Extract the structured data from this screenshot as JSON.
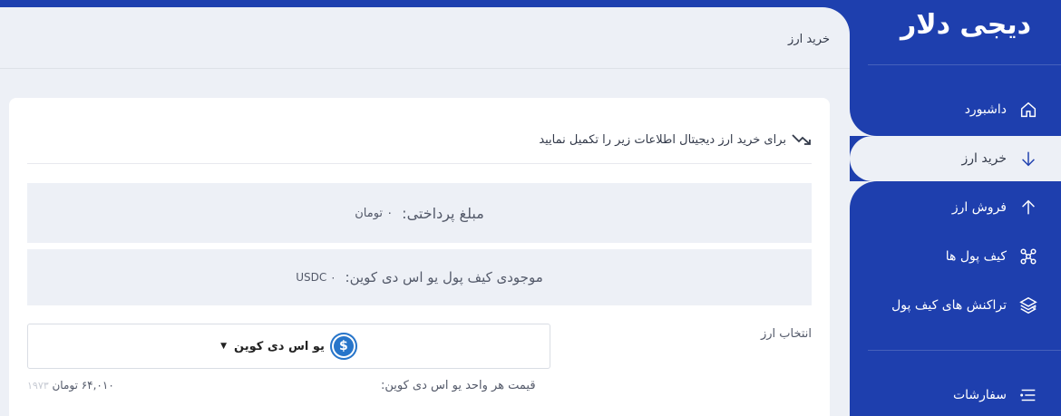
{
  "sidebar": {
    "logo": "دیجی دلار",
    "items": [
      {
        "label": "داشبورد",
        "icon": "home-icon"
      },
      {
        "label": "خرید ارز",
        "icon": "arrow-down-icon",
        "active": true
      },
      {
        "label": "فروش ارز",
        "icon": "arrow-up-icon"
      },
      {
        "label": "کیف پول ها",
        "icon": "wallet-grid-icon"
      },
      {
        "label": "تراکنش های کیف پول",
        "icon": "layers-icon",
        "has_dropdown": true
      },
      {
        "label": "سفارشات",
        "icon": "list-icon"
      }
    ]
  },
  "header": {
    "title": "خرید ارز"
  },
  "card": {
    "intro": "برای خرید ارز دیجیتال اطلاعات زیر را تکمیل نمایید",
    "payment": {
      "label": "مبلغ پرداختی:",
      "value": "۰ تومان"
    },
    "balance": {
      "label": "موجودی کیف پول یو اس دی کوین:",
      "value": "USDC ۰"
    },
    "currency_select": {
      "label": "انتخاب ارز",
      "selected": "یو اس دی کوین",
      "coin_symbol": "$"
    },
    "unit_price": {
      "label": "قیمت هر واحد یو اس دی کوین:",
      "value": "۶۴,۰۱۰ تومان",
      "faint": "۱۹۷۳"
    }
  },
  "colors": {
    "primary": "#1e3fae",
    "background": "#edf0f6",
    "coin": "#2775ca"
  }
}
